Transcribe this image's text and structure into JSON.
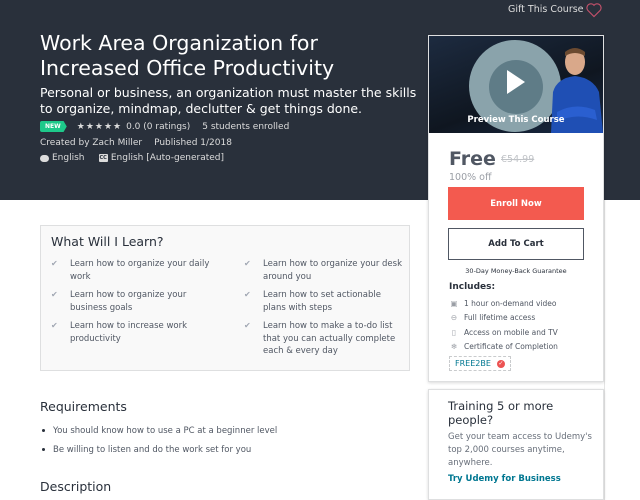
{
  "header": {
    "gift_label": "Gift This Course",
    "wishlist_icon": "heart-icon"
  },
  "course": {
    "title": "Work Area Organization for Increased Office Productivity",
    "subtitle": "Personal or business, an organization must master the skills to organize, mindmap, declutter & get things done.",
    "badge": "NEW",
    "stars": "★★★★★",
    "rating_text": "0.0 (0 ratings)",
    "students": "5 students enrolled",
    "created_by": "Created by Zach Miller",
    "published": "Published 1/2018",
    "language": "English",
    "captions": "English [Auto-generated]",
    "cc_label": "CC"
  },
  "sidebar": {
    "preview_label": "Preview This Course",
    "price": "Free",
    "original_price": "€54.99",
    "discount": "100% off",
    "enroll_label": "Enroll Now",
    "cart_label": "Add To Cart",
    "guarantee": "30-Day Money-Back Guarantee",
    "includes_title": "Includes:",
    "includes": [
      {
        "icon": "video-icon",
        "glyph": "▣",
        "label": "1 hour on-demand video"
      },
      {
        "icon": "infinity-icon",
        "glyph": "⊖",
        "label": "Full lifetime access"
      },
      {
        "icon": "mobile-icon",
        "glyph": "▯",
        "label": "Access on mobile and TV"
      },
      {
        "icon": "certificate-icon",
        "glyph": "❄",
        "label": "Certificate of Completion"
      }
    ],
    "coupon_code": "FREE2BE"
  },
  "business": {
    "title": "Training 5 or more people?",
    "text": "Get your team access to Udemy's top 2,000 courses anytime, anywhere.",
    "link": "Try Udemy for Business"
  },
  "learn": {
    "title": "What Will I Learn?",
    "col1": [
      "Learn how to organize your daily work",
      "Learn how to organize your business goals",
      "Learn how to increase work productivity"
    ],
    "col2": [
      "Learn how to organize your desk around you",
      "Learn how to set actionable plans with steps",
      "Learn how to make a to-do list that you can actually complete each & every day"
    ]
  },
  "requirements": {
    "title": "Requirements",
    "items": [
      "You should know how to use a PC at a beginner level",
      "Be willing to listen and do the work set for you"
    ]
  },
  "description": {
    "title": "Description"
  },
  "colors": {
    "hero_bg": "#29303b",
    "enroll": "#f35a4f",
    "link": "#007791",
    "new_badge": "#1ec98a"
  }
}
